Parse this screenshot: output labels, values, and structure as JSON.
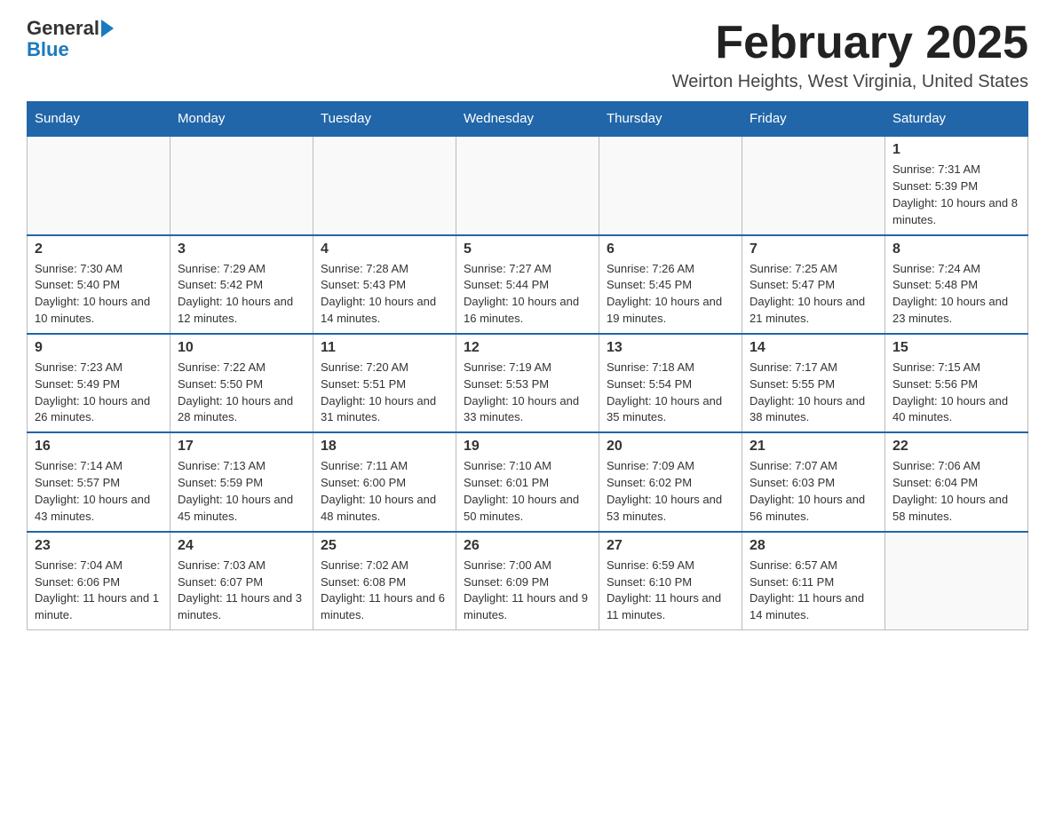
{
  "logo": {
    "general": "General",
    "blue": "Blue"
  },
  "title": "February 2025",
  "location": "Weirton Heights, West Virginia, United States",
  "weekdays": [
    "Sunday",
    "Monday",
    "Tuesday",
    "Wednesday",
    "Thursday",
    "Friday",
    "Saturday"
  ],
  "weeks": [
    [
      {
        "day": "",
        "info": ""
      },
      {
        "day": "",
        "info": ""
      },
      {
        "day": "",
        "info": ""
      },
      {
        "day": "",
        "info": ""
      },
      {
        "day": "",
        "info": ""
      },
      {
        "day": "",
        "info": ""
      },
      {
        "day": "1",
        "info": "Sunrise: 7:31 AM\nSunset: 5:39 PM\nDaylight: 10 hours and 8 minutes."
      }
    ],
    [
      {
        "day": "2",
        "info": "Sunrise: 7:30 AM\nSunset: 5:40 PM\nDaylight: 10 hours and 10 minutes."
      },
      {
        "day": "3",
        "info": "Sunrise: 7:29 AM\nSunset: 5:42 PM\nDaylight: 10 hours and 12 minutes."
      },
      {
        "day": "4",
        "info": "Sunrise: 7:28 AM\nSunset: 5:43 PM\nDaylight: 10 hours and 14 minutes."
      },
      {
        "day": "5",
        "info": "Sunrise: 7:27 AM\nSunset: 5:44 PM\nDaylight: 10 hours and 16 minutes."
      },
      {
        "day": "6",
        "info": "Sunrise: 7:26 AM\nSunset: 5:45 PM\nDaylight: 10 hours and 19 minutes."
      },
      {
        "day": "7",
        "info": "Sunrise: 7:25 AM\nSunset: 5:47 PM\nDaylight: 10 hours and 21 minutes."
      },
      {
        "day": "8",
        "info": "Sunrise: 7:24 AM\nSunset: 5:48 PM\nDaylight: 10 hours and 23 minutes."
      }
    ],
    [
      {
        "day": "9",
        "info": "Sunrise: 7:23 AM\nSunset: 5:49 PM\nDaylight: 10 hours and 26 minutes."
      },
      {
        "day": "10",
        "info": "Sunrise: 7:22 AM\nSunset: 5:50 PM\nDaylight: 10 hours and 28 minutes."
      },
      {
        "day": "11",
        "info": "Sunrise: 7:20 AM\nSunset: 5:51 PM\nDaylight: 10 hours and 31 minutes."
      },
      {
        "day": "12",
        "info": "Sunrise: 7:19 AM\nSunset: 5:53 PM\nDaylight: 10 hours and 33 minutes."
      },
      {
        "day": "13",
        "info": "Sunrise: 7:18 AM\nSunset: 5:54 PM\nDaylight: 10 hours and 35 minutes."
      },
      {
        "day": "14",
        "info": "Sunrise: 7:17 AM\nSunset: 5:55 PM\nDaylight: 10 hours and 38 minutes."
      },
      {
        "day": "15",
        "info": "Sunrise: 7:15 AM\nSunset: 5:56 PM\nDaylight: 10 hours and 40 minutes."
      }
    ],
    [
      {
        "day": "16",
        "info": "Sunrise: 7:14 AM\nSunset: 5:57 PM\nDaylight: 10 hours and 43 minutes."
      },
      {
        "day": "17",
        "info": "Sunrise: 7:13 AM\nSunset: 5:59 PM\nDaylight: 10 hours and 45 minutes."
      },
      {
        "day": "18",
        "info": "Sunrise: 7:11 AM\nSunset: 6:00 PM\nDaylight: 10 hours and 48 minutes."
      },
      {
        "day": "19",
        "info": "Sunrise: 7:10 AM\nSunset: 6:01 PM\nDaylight: 10 hours and 50 minutes."
      },
      {
        "day": "20",
        "info": "Sunrise: 7:09 AM\nSunset: 6:02 PM\nDaylight: 10 hours and 53 minutes."
      },
      {
        "day": "21",
        "info": "Sunrise: 7:07 AM\nSunset: 6:03 PM\nDaylight: 10 hours and 56 minutes."
      },
      {
        "day": "22",
        "info": "Sunrise: 7:06 AM\nSunset: 6:04 PM\nDaylight: 10 hours and 58 minutes."
      }
    ],
    [
      {
        "day": "23",
        "info": "Sunrise: 7:04 AM\nSunset: 6:06 PM\nDaylight: 11 hours and 1 minute."
      },
      {
        "day": "24",
        "info": "Sunrise: 7:03 AM\nSunset: 6:07 PM\nDaylight: 11 hours and 3 minutes."
      },
      {
        "day": "25",
        "info": "Sunrise: 7:02 AM\nSunset: 6:08 PM\nDaylight: 11 hours and 6 minutes."
      },
      {
        "day": "26",
        "info": "Sunrise: 7:00 AM\nSunset: 6:09 PM\nDaylight: 11 hours and 9 minutes."
      },
      {
        "day": "27",
        "info": "Sunrise: 6:59 AM\nSunset: 6:10 PM\nDaylight: 11 hours and 11 minutes."
      },
      {
        "day": "28",
        "info": "Sunrise: 6:57 AM\nSunset: 6:11 PM\nDaylight: 11 hours and 14 minutes."
      },
      {
        "day": "",
        "info": ""
      }
    ]
  ]
}
